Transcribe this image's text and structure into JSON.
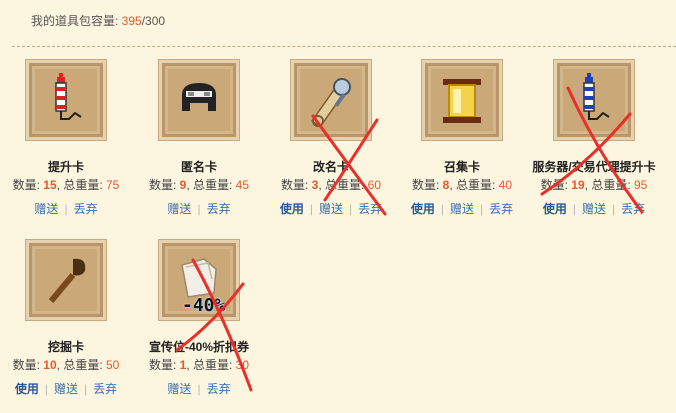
{
  "capacity": {
    "label": "我的道具包容量: ",
    "used": "395",
    "sep": "/",
    "total": "300"
  },
  "labels": {
    "qty": "数量: ",
    "weight": ", 总重量: ",
    "use": "使用",
    "gift": "赠送",
    "discard": "丢弃"
  },
  "items": [
    {
      "name": "提升卡",
      "qty": "15",
      "weight": "75",
      "icon": "firework-red-icon",
      "has_use": false
    },
    {
      "name": "匿名卡",
      "qty": "9",
      "weight": "45",
      "icon": "mask-icon",
      "has_use": false
    },
    {
      "name": "改名卡",
      "qty": "3",
      "weight": "60",
      "icon": "rename-scroll-icon",
      "has_use": true,
      "crossed": true
    },
    {
      "name": "召集卡",
      "qty": "8",
      "weight": "40",
      "icon": "summon-scroll-icon",
      "has_use": true
    },
    {
      "name": "服务器/交易代理提升卡",
      "qty": "19",
      "weight": "95",
      "icon": "firework-blue-icon",
      "has_use": true,
      "crossed": true
    },
    {
      "name": "挖掘卡",
      "qty": "10",
      "weight": "50",
      "icon": "shovel-icon",
      "has_use": true
    },
    {
      "name": "宣传位-40%折扣券",
      "qty": "1",
      "weight": "30",
      "icon": "coupon-icon",
      "has_use": false,
      "crossed": true,
      "badge": "-40%"
    }
  ],
  "colors": {
    "highlight": "#e55a2b",
    "link": "#3b6fb0",
    "cross": "#e8302a",
    "background": "#fcf5df"
  }
}
